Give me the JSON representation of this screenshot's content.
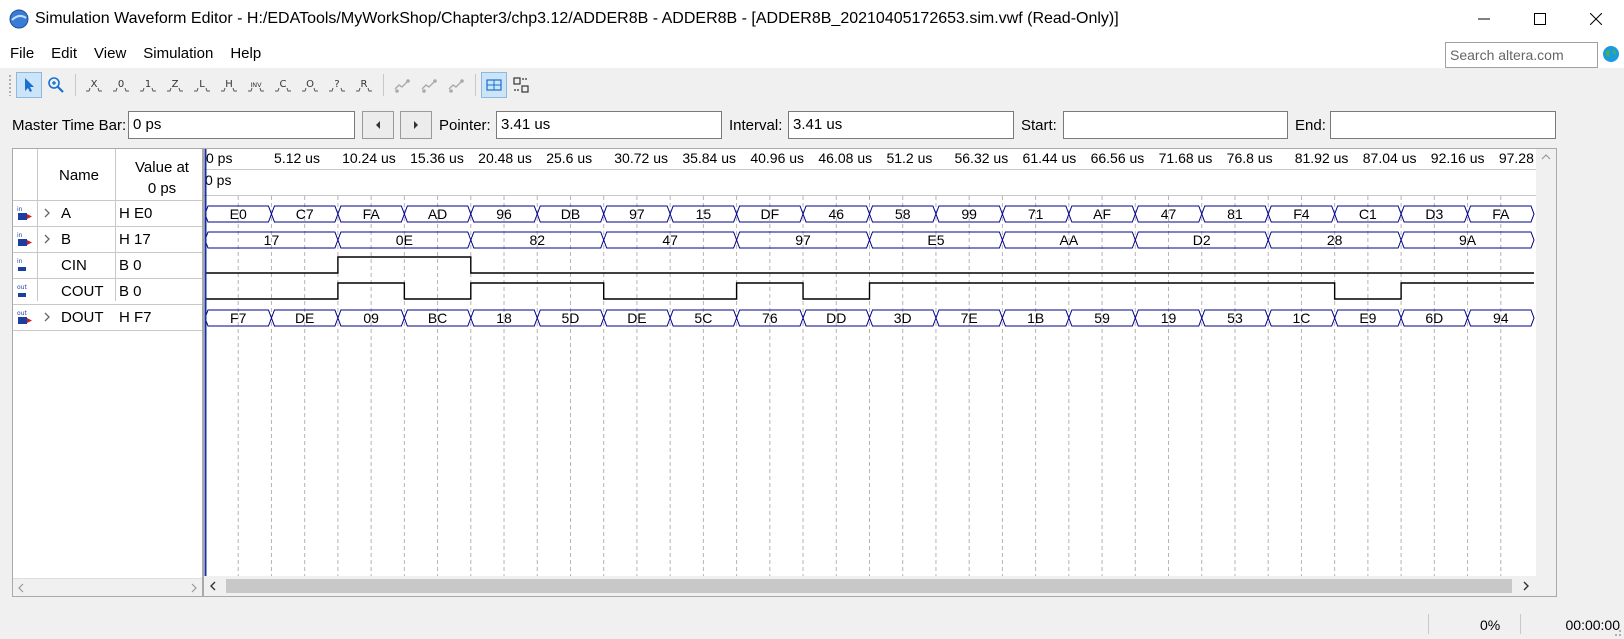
{
  "window": {
    "title": "Simulation Waveform Editor - H:/EDATools/MyWorkShop/Chapter3/chp3.12/ADDER8B - ADDER8B - [ADDER8B_20210405172653.sim.vwf (Read-Only)]"
  },
  "menu": {
    "items": [
      "File",
      "Edit",
      "View",
      "Simulation",
      "Help"
    ],
    "search_placeholder": "Search altera.com"
  },
  "toolbar": {
    "buttons": [
      {
        "icon": "selection-pointer-icon",
        "label": ""
      },
      {
        "icon": "zoom-icon",
        "label": ""
      },
      {
        "icon": "force-unknown-icon",
        "label": ""
      },
      {
        "icon": "force-low-icon",
        "label": "0"
      },
      {
        "icon": "force-high-icon",
        "label": "1"
      },
      {
        "icon": "force-high-impedance-icon",
        "label": "Z"
      },
      {
        "icon": "force-weak-low-icon",
        "label": "L"
      },
      {
        "icon": "force-weak-high-icon",
        "label": "H"
      },
      {
        "icon": "invert-icon",
        "label": "INV"
      },
      {
        "icon": "count-value-icon",
        "label": "C"
      },
      {
        "icon": "overwrite-clock-icon",
        "label": ""
      },
      {
        "icon": "dont-care-icon",
        "label": "?"
      },
      {
        "icon": "random-values-icon",
        "label": "R"
      },
      {
        "icon": "snap-to-grid-icon",
        "label": ""
      },
      {
        "icon": "grid-settings-icon",
        "label": ""
      },
      {
        "icon": "sort-icon",
        "label": ""
      },
      {
        "icon": "waveform-view-icon",
        "label": ""
      },
      {
        "icon": "grid-icon",
        "label": ""
      }
    ]
  },
  "timebar": {
    "master_label": "Master Time Bar:",
    "master_value": "0 ps",
    "pointer_label": "Pointer:",
    "pointer_value": "3.41 us",
    "interval_label": "Interval:",
    "interval_value": "3.41 us",
    "start_label": "Start:",
    "start_value": "",
    "end_label": "End:",
    "end_value": ""
  },
  "signal_list": {
    "name_header": "Name",
    "value_header_line1": "Value at",
    "value_header_line2": "0 ps",
    "signals": [
      {
        "name": "A",
        "value": "H E0",
        "direction": "in",
        "expandable": true
      },
      {
        "name": "B",
        "value": "H 17",
        "direction": "in",
        "expandable": true
      },
      {
        "name": "CIN",
        "value": "B 0",
        "direction": "in",
        "expandable": false
      },
      {
        "name": "COUT",
        "value": "B 0",
        "direction": "out",
        "expandable": false
      },
      {
        "name": "DOUT",
        "value": "H F7",
        "direction": "out",
        "expandable": true
      }
    ]
  },
  "waveform": {
    "time_ticks": [
      "0 ps",
      "5.12 us",
      "10.24 us",
      "15.36 us",
      "20.48 us",
      "25.6 us",
      "30.72 us",
      "35.84 us",
      "40.96 us",
      "46.08 us",
      "51.2 us",
      "56.32 us",
      "61.44 us",
      "66.56 us",
      "71.68 us",
      "76.8 us",
      "81.92 us",
      "87.04 us",
      "92.16 us",
      "97.28 us"
    ],
    "time_span_us": 100,
    "master_marker_label": "0 ps",
    "bus_color": "#00008b",
    "bit_color": "#000000",
    "buses": {
      "A": {
        "period_us": 5,
        "values": [
          "E0",
          "C7",
          "FA",
          "AD",
          "96",
          "DB",
          "97",
          "15",
          "DF",
          "46",
          "58",
          "99",
          "71",
          "AF",
          "47",
          "81",
          "F4",
          "C1",
          "D3",
          "FA"
        ]
      },
      "B": {
        "period_us": 10,
        "values": [
          "17",
          "0E",
          "82",
          "47",
          "97",
          "E5",
          "AA",
          "D2",
          "28",
          "9A"
        ]
      },
      "DOUT": {
        "period_us": 5,
        "values": [
          "F7",
          "DE",
          "09",
          "BC",
          "18",
          "5D",
          "DE",
          "5C",
          "76",
          "DD",
          "3D",
          "7E",
          "1B",
          "59",
          "19",
          "53",
          "1C",
          "E9",
          "6D",
          "94"
        ]
      }
    },
    "bits": {
      "CIN": [
        [
          0,
          0
        ],
        [
          10,
          1
        ],
        [
          20,
          0
        ]
      ],
      "COUT": [
        [
          0,
          0
        ],
        [
          10,
          1
        ],
        [
          15,
          0
        ],
        [
          20,
          1
        ],
        [
          30,
          0
        ],
        [
          40,
          1
        ],
        [
          45,
          0
        ],
        [
          50,
          1
        ],
        [
          85,
          0
        ],
        [
          90,
          1
        ]
      ]
    }
  },
  "status": {
    "progress": "0%",
    "elapsed": "00:00:00"
  }
}
